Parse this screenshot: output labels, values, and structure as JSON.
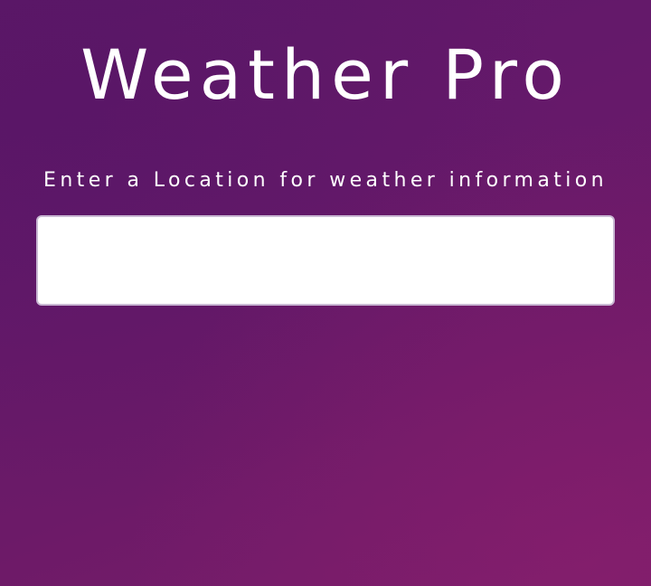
{
  "app": {
    "title": "Weather Pro"
  },
  "search": {
    "prompt": "Enter a Location for weather information",
    "value": ""
  },
  "colors": {
    "background_start": "#5e1868",
    "background_end": "#7a1d6a",
    "text": "#ffffff",
    "input_background": "#ffffff",
    "input_border": "#c9b8d3"
  }
}
